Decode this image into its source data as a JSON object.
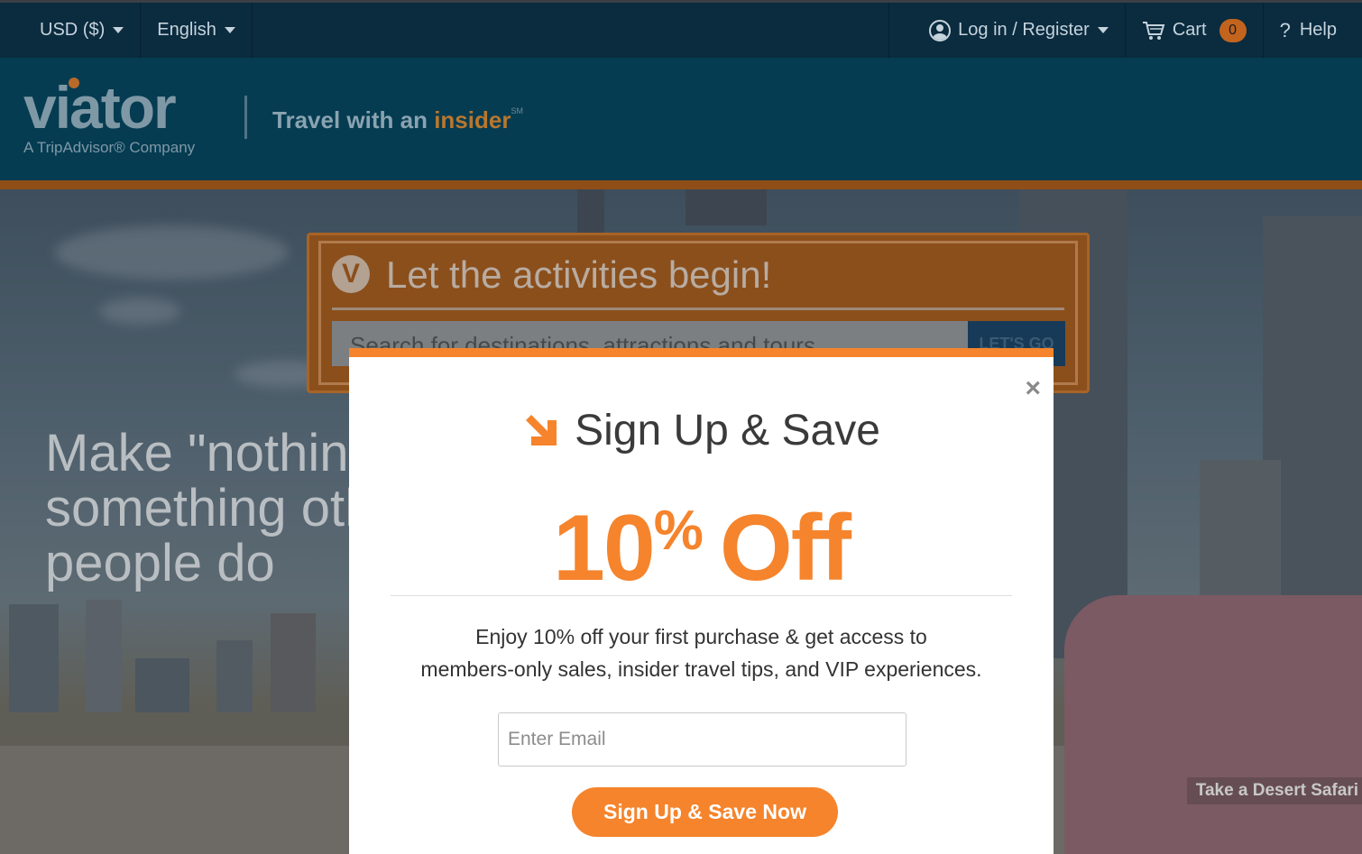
{
  "topbar": {
    "currency": "USD ($)",
    "language": "English",
    "login": "Log in / Register",
    "cart_label": "Cart",
    "cart_count": "0",
    "help": "Help"
  },
  "header": {
    "logo_text": "viator",
    "logo_sub": "A TripAdvisor® Company",
    "tagline_prefix": "Travel with an",
    "tagline_accent": "insider",
    "tagline_mark": "SM"
  },
  "hero": {
    "line1": "Make \"nothing",
    "line2": "something oth",
    "line3": "people do",
    "caption": "Take a Desert Safari"
  },
  "search": {
    "icon_letter": "V",
    "title": "Let the activities begin!",
    "placeholder": "Search for destinations, attractions and tours",
    "button": "LET'S GO"
  },
  "modal": {
    "close": "×",
    "title": "Sign Up & Save",
    "offer_number": "10",
    "offer_percent": "%",
    "offer_word": "Off",
    "description_line1": "Enjoy 10% off your first purchase & get access to",
    "description_line2": "members-only sales, insider travel tips, and VIP experiences.",
    "email_placeholder": "Enter Email",
    "cta": "Sign Up & Save Now"
  },
  "colors": {
    "accent": "#f5842c",
    "topbar": "#0b2b3f",
    "header": "#053c52"
  },
  "icons": {
    "user": "user-icon",
    "cart": "cart-icon",
    "help": "question-icon",
    "close": "close-icon",
    "arrow": "arrow-down-right-icon"
  }
}
